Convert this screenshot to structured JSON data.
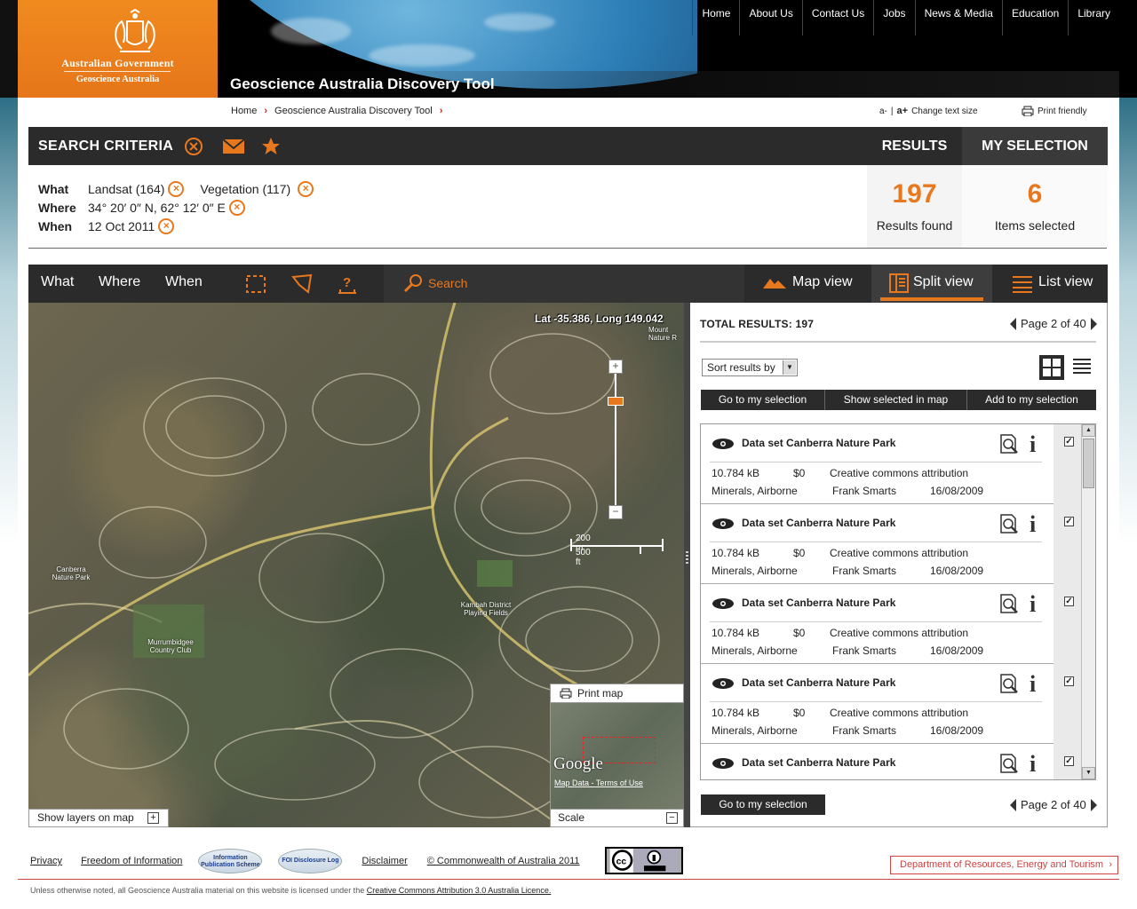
{
  "header": {
    "gov_name": "Australian Government",
    "agency_name": "Geoscience Australia",
    "site_title": "Geoscience Australia Discovery Tool",
    "nav": [
      "Home",
      "About Us",
      "Contact Us",
      "Jobs",
      "News & Media",
      "Education",
      "Library"
    ]
  },
  "breadcrumb": {
    "home": "Home",
    "current": "Geoscience Australia Discovery Tool"
  },
  "utility": {
    "text_small": "a-",
    "text_large": "a+",
    "change_text": "Change text size",
    "print_friendly": "Print friendly"
  },
  "criteria": {
    "title": "SEARCH CRITERIA",
    "what_label": "What",
    "what_value1": "Landsat (164)",
    "what_value2": "Vegetation (117)",
    "where_label": "Where",
    "where_value": "34° 20′ 0″ N, 62° 12′ 0″ E",
    "when_label": "When",
    "when_value": "12 Oct 2011",
    "icons": [
      "clear-icon",
      "email-icon",
      "star-icon"
    ]
  },
  "summary": {
    "results_tab": "RESULTS",
    "selection_tab": "MY SELECTION",
    "results_count": "197",
    "results_label": "Results found",
    "selected_count": "6",
    "selected_label": "Items selected"
  },
  "toolbar": {
    "tabs": [
      "What",
      "Where",
      "When"
    ],
    "search": "Search",
    "map_view": "Map view",
    "split_view": "Split view",
    "list_view": "List view",
    "accent": "#e8781e"
  },
  "map": {
    "latlong": "Lat -35.386, Long 149.042",
    "scale_m": "200 m",
    "scale_ft": "500 ft",
    "print_map": "Print map",
    "google": "Google",
    "terms": "Map Data - Terms of Use",
    "scale": "Scale",
    "show_layers": "Show layers on map",
    "labels": {
      "canberra_nature_park": "Canberra Nature Park",
      "murrumbidgee": "Murrumbidgee Country Club",
      "kambah": "Kambah District Playing Fields",
      "mount": "Mount Nature R"
    }
  },
  "results": {
    "total": "TOTAL RESULTS: 197",
    "page": "Page 2 of 40",
    "sort": "Sort results by",
    "actions": [
      "Go to my selection",
      "Show selected in map",
      "Add to my selection"
    ],
    "go_bottom": "Go to my selection",
    "items": [
      {
        "name": "Data set Canberra Nature Park",
        "size": "10.784 kB",
        "price": "$0",
        "license": "Creative commons attribution",
        "category": "Minerals, Airborne",
        "author": "Frank Smarts",
        "date": "16/08/2009",
        "checked": true
      },
      {
        "name": "Data set Canberra Nature Park",
        "size": "10.784 kB",
        "price": "$0",
        "license": "Creative commons attribution",
        "category": "Minerals, Airborne",
        "author": "Frank Smarts",
        "date": "16/08/2009",
        "checked": true
      },
      {
        "name": "Data set Canberra Nature Park",
        "size": "10.784 kB",
        "price": "$0",
        "license": "Creative commons attribution",
        "category": "Minerals, Airborne",
        "author": "Frank Smarts",
        "date": "16/08/2009",
        "checked": true
      },
      {
        "name": "Data set Canberra Nature Park",
        "size": "10.784 kB",
        "price": "$0",
        "license": "Creative commons attribution",
        "category": "Minerals, Airborne",
        "author": "Frank Smarts",
        "date": "16/08/2009",
        "checked": true
      },
      {
        "name": "Data set Canberra Nature Park",
        "size": "",
        "price": "",
        "license": "",
        "category": "",
        "author": "",
        "date": "",
        "checked": true
      }
    ]
  },
  "footer": {
    "privacy": "Privacy",
    "foi": "Freedom of Information",
    "ips_badge": "Information Publication Scheme",
    "foi_badge": "FOI Disclosure Log",
    "disclaimer": "Disclaimer",
    "copyright": "© Commonwealth of Australia 2011",
    "dept": "Department of Resources, Energy and Tourism",
    "license_text": "Unless otherwise noted, all Geoscience Australia material on this website is licensed under the",
    "license_link": "Creative Commons Attribution 3.0 Australia Licence."
  }
}
